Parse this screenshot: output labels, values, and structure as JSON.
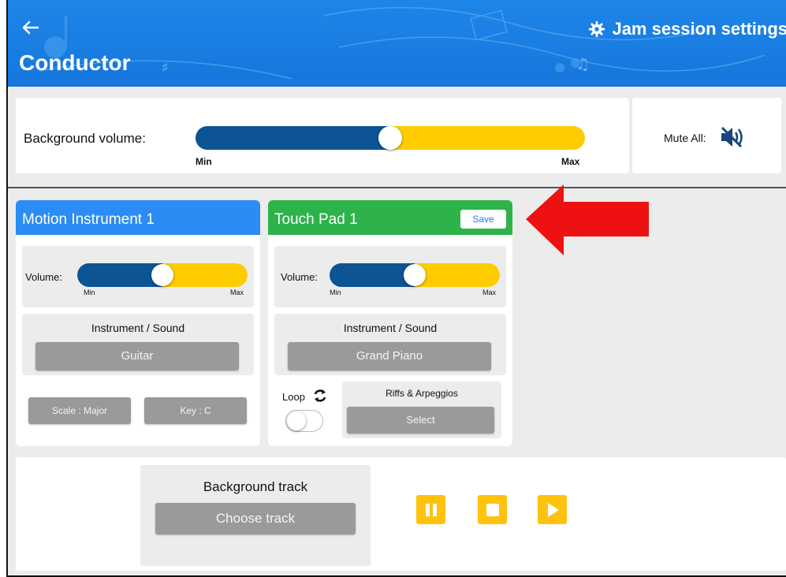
{
  "header": {
    "title": "Conductor",
    "settings_label": "Jam session settings",
    "back_icon": "arrow-left-icon",
    "settings_icon": "gear-icon"
  },
  "background_volume": {
    "label": "Background volume:",
    "min_label": "Min",
    "max_label": "Max",
    "value": 0.5
  },
  "mute": {
    "label": "Mute All:",
    "icon": "volume-muted-icon"
  },
  "motion_instrument": {
    "title": "Motion Instrument 1",
    "volume_label": "Volume:",
    "min_label": "Min",
    "max_label": "Max",
    "volume_value": 0.5,
    "sound_title": "Instrument / Sound",
    "sound_value": "Guitar",
    "scale_label": "Scale : Major",
    "key_label": "Key : C"
  },
  "touch_pad": {
    "title": "Touch Pad 1",
    "save_label": "Save",
    "volume_label": "Volume:",
    "min_label": "Min",
    "max_label": "Max",
    "volume_value": 0.5,
    "sound_title": "Instrument / Sound",
    "sound_value": "Grand Piano",
    "loop_label": "Loop",
    "loop_on": false,
    "riffs_title": "Riffs & Arpeggios",
    "riffs_button": "Select"
  },
  "track": {
    "title": "Background track",
    "choose_label": "Choose track",
    "pause_icon": "pause-icon",
    "stop_icon": "stop-icon",
    "play_icon": "play-icon"
  },
  "colors": {
    "header_blue": "#1e86e8",
    "motion_header": "#2a8cf4",
    "touch_header": "#2db34a",
    "slider_left": "#0d5494",
    "slider_right": "#ffcc00",
    "transport_yellow": "#ffc20e",
    "annotation_arrow": "#ee1111"
  }
}
